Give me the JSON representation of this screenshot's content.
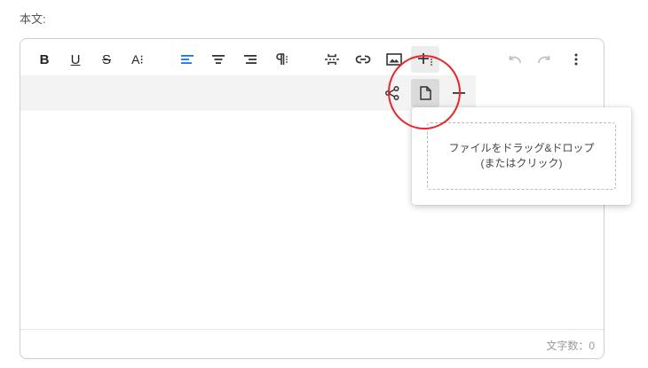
{
  "form": {
    "field_label": "本文:"
  },
  "toolbar": {
    "bold_label": "B",
    "underline_label": "U",
    "strikethrough_label": "S",
    "font_size_label": "A⁝"
  },
  "insert_menu": {
    "items": [
      "link-share",
      "file",
      "horizontal-rule"
    ],
    "selected": "file"
  },
  "file_dropzone": {
    "line1": "ファイルをドラッグ&ドロップ",
    "line2": "(またはクリック)"
  },
  "footer": {
    "char_count": "文字数：0"
  },
  "colors": {
    "accent": "#1a73e8",
    "highlight": "#e8262b"
  }
}
